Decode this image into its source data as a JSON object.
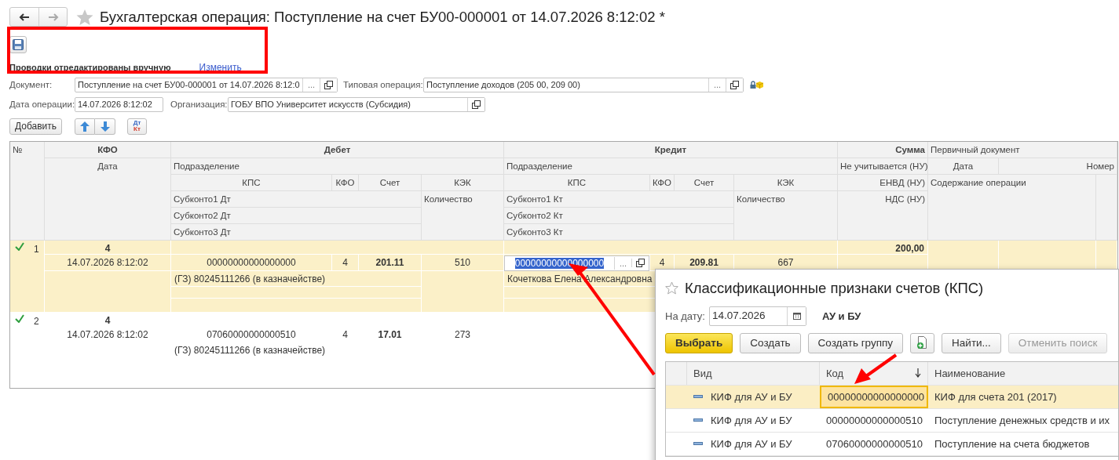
{
  "title": "Бухгалтерская операция: Поступление на счет БУ00-000001 от 14.07.2026 8:12:02 *",
  "notice": {
    "text": "Проводки отредактированы вручную",
    "link": "Изменить"
  },
  "fields": [
    {
      "label": "Документ:",
      "value": "Поступление на счет БУ00-000001 от 14.07.2026 8:12:0",
      "choice_button": "...",
      "open_button": true
    },
    {
      "label": "Типовая операция:",
      "value": "Поступление доходов (205 00, 209 00)",
      "choice_button": "...",
      "open_button": true
    },
    {
      "label": "Дата операции:",
      "value": "14.07.2026  8:12:02",
      "open_button": false
    },
    {
      "label": "Организация:",
      "value": "ГОБУ ВПО Университет искусств (Субсидия)",
      "open_button": true
    }
  ],
  "toolbar": {
    "add": "Добавить",
    "dt": "Дт",
    "kt": "Кт"
  },
  "table": {
    "header": {
      "number": "№",
      "kfo": "КФО",
      "date": "Дата",
      "debit": "Дебет",
      "debit_division": "Подразделение",
      "debit_kps": "КПС",
      "debit_kfo": "КФО",
      "debit_account": "Счет",
      "debit_kek": "КЭК",
      "debit_subconto": [
        "Субконто1 Дт",
        "Субконто2 Дт",
        "Субконто3 Дт"
      ],
      "debit_quantity": "Количество",
      "credit": "Кредит",
      "credit_division": "Подразделение",
      "credit_kps": "КПС",
      "credit_kfo": "КФО",
      "credit_account": "Счет",
      "credit_kek": "КЭК",
      "credit_subconto": [
        "Субконто1 Кт",
        "Субконто2 Кт",
        "Субконто3 Кт"
      ],
      "credit_quantity": "Количество",
      "sum": "Сумма",
      "not_counted": "Не учитывается (НУ)",
      "envd": "ЕНВД (НУ)",
      "vat": "НДС (НУ)",
      "primary_document": "Первичный документ",
      "primary_date": "Дата",
      "primary_number": "Номер",
      "content": "Содержание операции"
    },
    "rows": [
      {
        "number": "1",
        "valid": true,
        "selected": true,
        "kfo": "4",
        "date": "14.07.2026 8:12:02",
        "debit_kps": "00000000000000000",
        "debit_kfo": "4",
        "debit_account": "201.11",
        "debit_kek": "510",
        "debit_subconto": [
          "(ГЗ) 80245111266 (в казначействе)"
        ],
        "credit_kps": "00000000000000000",
        "credit_kps_editing": true,
        "credit_choice_button": "...",
        "credit_kfo": "4",
        "credit_account": "209.81",
        "credit_kek": "667",
        "credit_subconto": [
          "Кочеткова Елена Александровна"
        ],
        "sum": "200,00"
      },
      {
        "number": "2",
        "valid": true,
        "selected": false,
        "kfo": "4",
        "date": "14.07.2026 8:12:02",
        "debit_kps": "07060000000000510",
        "debit_kfo": "4",
        "debit_account": "17.01",
        "debit_kek": "273",
        "debit_subconto": [
          "(ГЗ) 80245111266 (в казначействе)"
        ]
      }
    ]
  },
  "popup": {
    "title": "Классификационные признаки счетов (КПС)",
    "date_label": "На дату:",
    "date": "14.07.2026",
    "scope": "АУ и БУ",
    "buttons": [
      {
        "kind": "primary",
        "label": "Выбрать",
        "disabled": false
      },
      {
        "kind": "text",
        "label": "Создать",
        "disabled": false
      },
      {
        "kind": "text",
        "label": "Создать группу",
        "disabled": false
      },
      {
        "kind": "icon",
        "disabled": false
      },
      {
        "kind": "text",
        "label": "Найти...",
        "disabled": false
      },
      {
        "kind": "text",
        "label": "Отменить поиск",
        "disabled": true
      }
    ],
    "columns": [
      "Вид",
      "Код",
      "Наименование"
    ],
    "rows": [
      {
        "type": "КИФ для АУ и БУ",
        "code": "00000000000000000",
        "name": "КИФ для счета 201 (2017)",
        "selected": true
      },
      {
        "type": "КИФ для АУ и БУ",
        "code": "00000000000000510",
        "name": "Поступление денежных средств и их",
        "selected": false
      },
      {
        "type": "КИФ для АУ и БУ",
        "code": "07060000000000510",
        "name": "Поступление на счета бюджетов",
        "selected": false
      }
    ]
  }
}
